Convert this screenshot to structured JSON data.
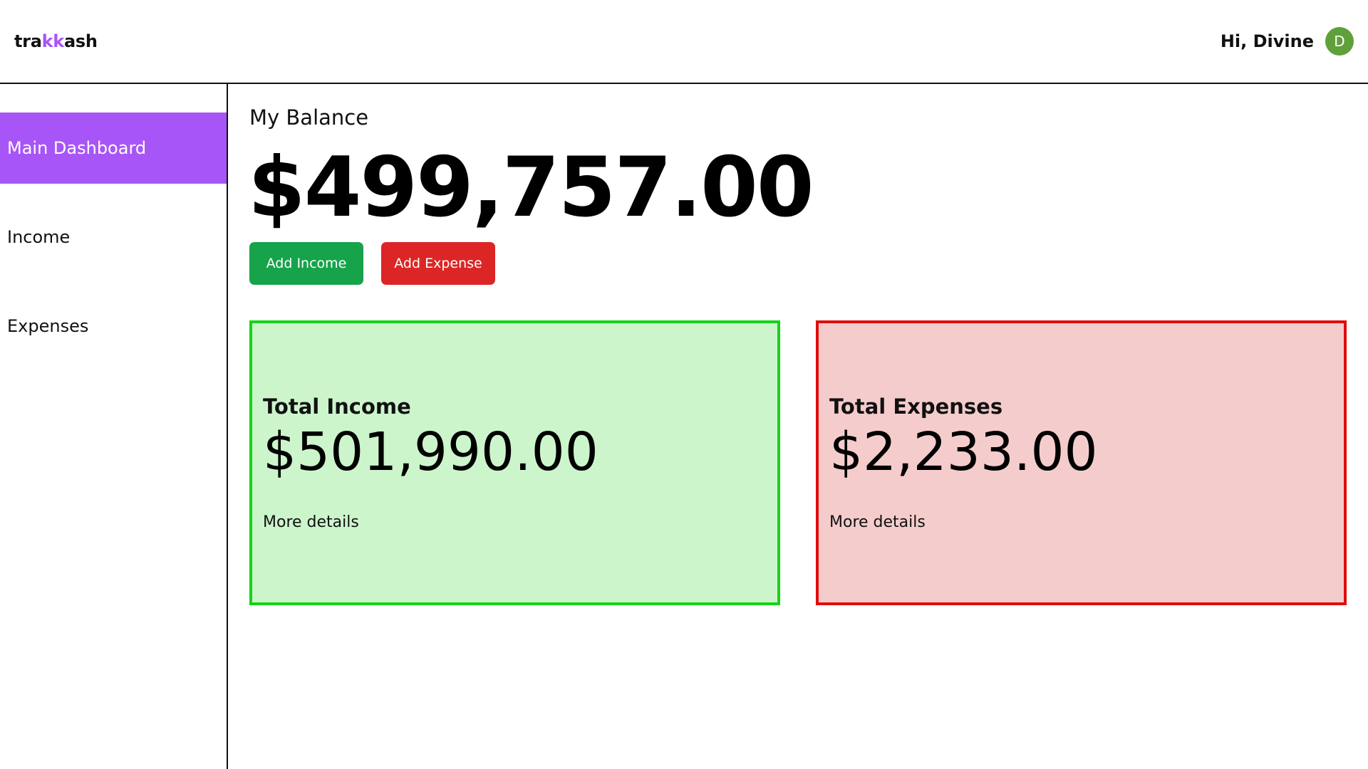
{
  "app": {
    "logo_prefix": "tra",
    "logo_accent": "kk",
    "logo_suffix": "ash",
    "accent_color": "#a855f7"
  },
  "header": {
    "greeting": "Hi, Divine",
    "avatar_initial": "D"
  },
  "sidebar": {
    "items": [
      {
        "label": "Main Dashboard",
        "active": true
      },
      {
        "label": "Income",
        "active": false
      },
      {
        "label": "Expenses",
        "active": false
      }
    ]
  },
  "main": {
    "balance_label": "My Balance",
    "balance_amount": "$499,757.00",
    "add_income_label": "Add Income",
    "add_expense_label": "Add Expense",
    "income_card": {
      "title": "Total Income",
      "amount": "$501,990.00",
      "link": "More details",
      "background": "#ccf5cc",
      "border": "#16d316"
    },
    "expense_card": {
      "title": "Total Expenses",
      "amount": "$2,233.00",
      "link": "More details",
      "background": "#f5cccc",
      "border": "#e00d0d"
    }
  },
  "colors": {
    "income_button": "#16a34a",
    "expense_button": "#dc2626",
    "avatar": "#5fa03b"
  }
}
